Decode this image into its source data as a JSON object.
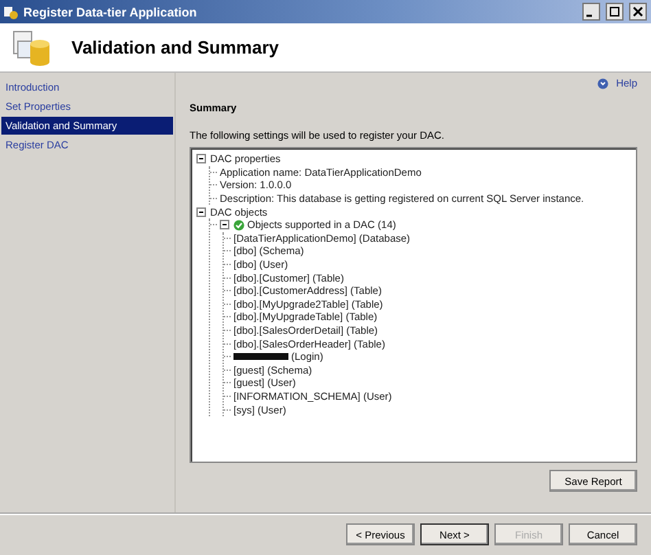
{
  "window": {
    "title": "Register Data-tier Application"
  },
  "header": {
    "title": "Validation and Summary"
  },
  "nav": [
    {
      "label": "Introduction",
      "selected": false
    },
    {
      "label": "Set Properties",
      "selected": false
    },
    {
      "label": "Validation and Summary",
      "selected": true
    },
    {
      "label": "Register DAC",
      "selected": false
    }
  ],
  "help": {
    "label": "Help"
  },
  "summary": {
    "heading": "Summary",
    "intro": "The following settings will be used to register your DAC.",
    "tree": [
      {
        "label": "DAC properties",
        "expanded": true,
        "children": [
          {
            "label": "Application name: DataTierApplicationDemo"
          },
          {
            "label": "Version: 1.0.0.0"
          },
          {
            "label": "Description: This database is getting registered on current SQL Server instance."
          }
        ]
      },
      {
        "label": "DAC objects",
        "expanded": true,
        "children": [
          {
            "label": "Objects supported in a DAC (14)",
            "expanded": true,
            "passed": true,
            "children": [
              {
                "label": "[DataTierApplicationDemo] (Database)"
              },
              {
                "label": "[dbo] (Schema)"
              },
              {
                "label": "[dbo] (User)"
              },
              {
                "label": "[dbo].[Customer] (Table)"
              },
              {
                "label": "[dbo].[CustomerAddress] (Table)"
              },
              {
                "label": "[dbo].[MyUpgrade2Table] (Table)"
              },
              {
                "label": "[dbo].[MyUpgradeTable] (Table)"
              },
              {
                "label": "[dbo].[SalesOrderDetail] (Table)"
              },
              {
                "label": "[dbo].[SalesOrderHeader] (Table)"
              },
              {
                "label": "(Login)",
                "redacted": true
              },
              {
                "label": "[guest] (Schema)"
              },
              {
                "label": "[guest] (User)"
              },
              {
                "label": "[INFORMATION_SCHEMA] (User)"
              },
              {
                "label": "[sys] (User)"
              }
            ]
          }
        ]
      }
    ]
  },
  "save_button": {
    "label": "Save Report"
  },
  "buttons": [
    {
      "label": "< Previous",
      "disabled": false,
      "default": false
    },
    {
      "label": "Next >",
      "disabled": false,
      "default": true
    },
    {
      "label": "Finish",
      "disabled": true,
      "default": false
    },
    {
      "label": "Cancel",
      "disabled": false,
      "default": false
    }
  ]
}
